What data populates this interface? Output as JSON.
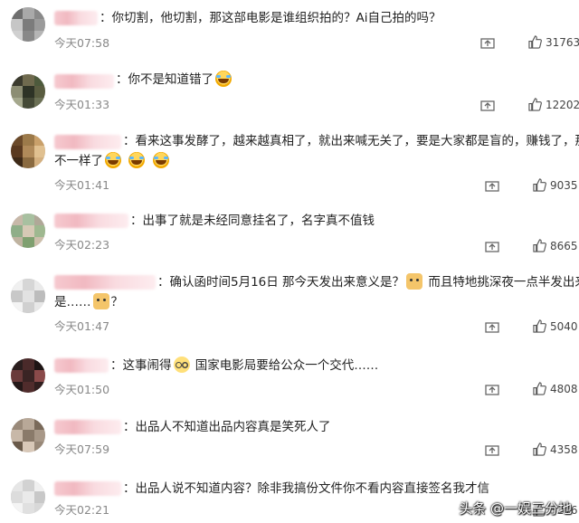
{
  "comments": [
    {
      "pre": "：",
      "text": "你切割，他切割，那这部电影是谁组织拍的？Ai自己拍的吗？",
      "time": "今天07:58",
      "likes": "31763",
      "avatar_colors": [
        "#6e6e6e",
        "#a9a9a9",
        "#8a8a8a",
        "#c6c6c6",
        "#7c7c7c",
        "#9b9b9b",
        "#d0d0d0",
        "#888888",
        "#b5b5b5"
      ]
    },
    {
      "pre": "：",
      "text": "你不是知道错了",
      "emoji": [
        "laugh-cry-emoji"
      ],
      "time": "今天01:33",
      "likes": "12202",
      "avatar_colors": [
        "#3b3b2e",
        "#6f6a4e",
        "#4d5a3c",
        "#8c8d73",
        "#2e3326",
        "#595c40",
        "#a5a88d",
        "#454a37",
        "#6b7055"
      ]
    },
    {
      "pre": "：",
      "text": "看来这事发酵了，越来越真相了，就出来喊无关了，要是大家都是盲的，赚钱了，那肯定",
      "text2": "不一样了",
      "emoji": [
        "laugh-cry-emoji",
        "laugh-cry-emoji",
        "laugh-cry-emoji"
      ],
      "time": "今天01:41",
      "likes": "9035",
      "avatar_colors": [
        "#6b4a2a",
        "#9c7a4a",
        "#c9a06a",
        "#5a3a20",
        "#b08a5a",
        "#e0c090",
        "#3e2a18",
        "#8a6a40",
        "#d4b080"
      ]
    },
    {
      "pre": "：",
      "text": "出事了就是未经同意挂名了，名字真不值钱",
      "time": "今天02:23",
      "likes": "8665",
      "avatar_colors": [
        "#c7b8a8",
        "#a8c0a0",
        "#b0a898",
        "#8fae88",
        "#d6c9b5",
        "#9fb890",
        "#bfb3a0",
        "#7fa070",
        "#cdbfab"
      ]
    },
    {
      "pre": "：",
      "text": "确认函时间5月16日 那今天发出来意义是？",
      "text_mid": "而且特地挑深夜一点半发出来又",
      "text2": "是……",
      "text2_end": "？",
      "emoji": [
        "doge-emoji",
        "doge-emoji"
      ],
      "time": "今天01:47",
      "likes": "5040",
      "avatar_colors": [
        "#f0f0f0",
        "#d6d6d6",
        "#eaeaea",
        "#c8c8c8",
        "#e2e2e2",
        "#bcbcbc",
        "#f4f4f4",
        "#d0d0d0",
        "#e8e8e8"
      ]
    },
    {
      "pre": "：",
      "text": "这事闹得",
      "text_mid": "国家电影局要给公众一个交代……",
      "emoji": [
        "glasses-emoji"
      ],
      "time": "今天01:50",
      "likes": "4808",
      "avatar_colors": [
        "#2a1e1e",
        "#4a2a2a",
        "#1e1414",
        "#6a3a3a",
        "#3a2424",
        "#8a4a4a",
        "#241818",
        "#502c2c",
        "#301e1e"
      ]
    },
    {
      "pre": "：",
      "text": "出品人不知道出品内容真是笑死人了",
      "time": "今天07:59",
      "likes": "4358",
      "avatar_colors": [
        "#9a8a7a",
        "#b8a898",
        "#7a6a5a",
        "#c8b8a8",
        "#8a7a6a",
        "#a89888",
        "#6a5a4a",
        "#d8c8b8",
        "#988878"
      ]
    },
    {
      "pre": "：",
      "text": "出品人说不知道内容？除非我搞份文件你不看内容直接签名我才信",
      "time": "今天02:21",
      "likes": "3216",
      "avatar_colors": [
        "#e6e6e6",
        "#d2d2d2",
        "#f0f0f0",
        "#dcdcdc",
        "#eaeaea",
        "#c8c8c8",
        "#f4f4f4",
        "#e0e0e0",
        "#d8d8d8"
      ]
    }
  ],
  "watermark": "头条 @一娱三分地",
  "icons": {
    "share": "share-icon",
    "like": "thumbs-up-icon"
  }
}
